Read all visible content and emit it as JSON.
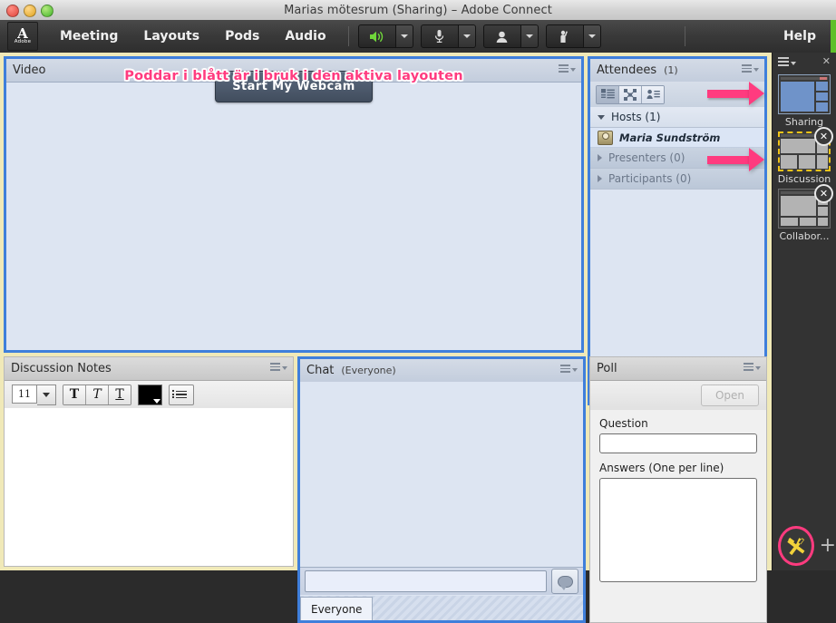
{
  "window": {
    "title": "Marias mötesrum (Sharing) – Adobe Connect",
    "traffic_close": "close-button",
    "traffic_minimize": "minimize-button",
    "traffic_zoom": "zoom-button"
  },
  "menubar": {
    "logo_letter": "A",
    "logo_name": "Adobe",
    "items": [
      {
        "label": "Meeting"
      },
      {
        "label": "Layouts"
      },
      {
        "label": "Pods"
      },
      {
        "label": "Audio"
      }
    ],
    "tools": [
      {
        "name": "speaker-icon",
        "glyph": "🔊",
        "active": true
      },
      {
        "name": "microphone-icon",
        "glyph": "🎤",
        "active": false
      },
      {
        "name": "webcam-icon",
        "glyph": "◉",
        "active": false
      },
      {
        "name": "raise-hand-icon",
        "glyph": "👤",
        "active": false
      }
    ],
    "help_label": "Help"
  },
  "pods": {
    "video": {
      "title": "Video",
      "start_webcam_label": "Start My Webcam",
      "annotation": "Poddar i blått är i bruk i den aktiva layouten"
    },
    "attendees": {
      "title": "Attendees",
      "count": "(1)",
      "view_toggles": [
        {
          "name": "list-view-icon",
          "active": true
        },
        {
          "name": "breakout-view-icon",
          "active": false
        },
        {
          "name": "status-view-icon",
          "active": false
        }
      ],
      "groups": [
        {
          "label": "Hosts (1)",
          "expanded": true,
          "members": [
            {
              "name": "Maria Sundström",
              "role_icon": "host-icon"
            }
          ]
        },
        {
          "label": "Presenters (0)",
          "expanded": false,
          "members": []
        },
        {
          "label": "Participants (0)",
          "expanded": false,
          "members": []
        }
      ]
    },
    "notes": {
      "title": "Discussion Notes",
      "font_size": "11",
      "bold_label": "T",
      "italic_label": "T",
      "underline_label": "T",
      "color": "#000000",
      "body_text": ""
    },
    "chat": {
      "title": "Chat",
      "scope": "(Everyone)",
      "message_value": "",
      "send_icon": "chat-bubble-icon",
      "tabs": [
        {
          "label": "Everyone",
          "active": true
        }
      ]
    },
    "poll": {
      "title": "Poll",
      "open_label": "Open",
      "open_disabled": true,
      "question_label": "Question",
      "question_value": "",
      "answers_label": "Answers (One per line)",
      "answers_value": ""
    }
  },
  "rail": {
    "layouts": [
      {
        "label": "Sharing",
        "state": "active",
        "closable": false
      },
      {
        "label": "Discussion",
        "state": "selected",
        "closable": true
      },
      {
        "label": "Collabor...",
        "state": "normal",
        "closable": true
      }
    ],
    "close_glyph": "✕",
    "tools_icon": "tools-icon",
    "tools_glyph": "✕",
    "add_layout_glyph": "+"
  },
  "annotations": {
    "accent_color": "#ff3b7f",
    "arrows": [
      {
        "name": "arrow-to-sharing-layout"
      },
      {
        "name": "arrow-to-discussion-layout"
      }
    ]
  }
}
